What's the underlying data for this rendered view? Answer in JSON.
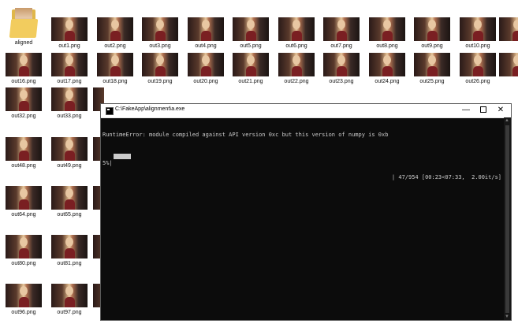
{
  "desktop": {
    "folder": {
      "label": "aligned"
    },
    "row1": [
      "out1.png",
      "out2.png",
      "out3.png",
      "out4.png",
      "out5.png",
      "out6.png",
      "out7.png",
      "out8.png",
      "out9.png",
      "out10.png"
    ],
    "row2": [
      "out16.png",
      "out17.png",
      "out18.png",
      "out19.png",
      "out20.png",
      "out21.png",
      "out22.png",
      "out23.png",
      "out24.png",
      "out25.png",
      "out26.png"
    ],
    "row3": [
      "out32.png",
      "out33.png"
    ],
    "row4": [
      "out48.png",
      "out49.png"
    ],
    "row5": [
      "out64.png",
      "out65.png"
    ],
    "row6": [
      "out80.png",
      "out81.png"
    ],
    "row7": [
      "out96.png",
      "out97.png"
    ]
  },
  "console": {
    "title": "C:\\FakeApp\\alignment\\a.exe",
    "line1": "RuntimeError: module compiled against API version 0xc but this version of numpy is 0xb",
    "progress_pct": "5%|",
    "progress_stats": "| 47/954 [00:23<07:33,  2.00it/s]",
    "progress_value": 0.05,
    "minimize": "—",
    "close": "✕"
  }
}
